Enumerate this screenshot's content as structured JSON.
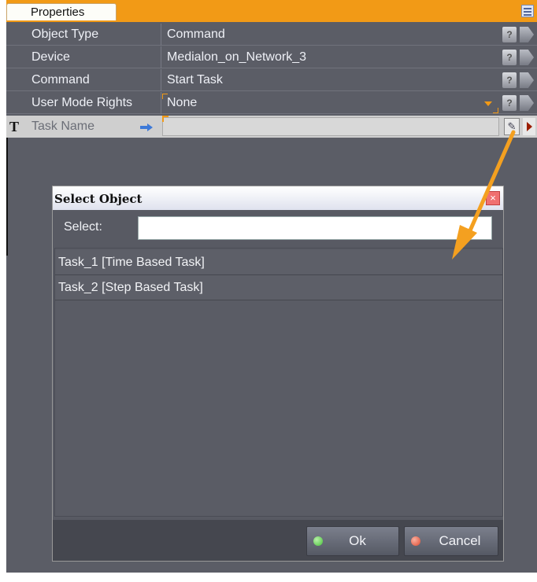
{
  "panel": {
    "tab_label": "Properties",
    "properties": [
      {
        "label": "Object Type",
        "value": "Command"
      },
      {
        "label": "Device",
        "value": "Medialon_on_Network_3"
      },
      {
        "label": "Command",
        "value": "Start Task"
      },
      {
        "label": "User Mode Rights",
        "value": "None"
      }
    ],
    "task_row": {
      "type_glyph": "T",
      "label": "Task Name",
      "value": ""
    },
    "help_glyph": "?",
    "icons": [
      "view-toggle-icon",
      "help-icon",
      "expand-arrow-icon",
      "dropdown-arrow-icon",
      "blue-right-arrow-icon",
      "object-picker-icon",
      "go-arrow-icon"
    ]
  },
  "dialog": {
    "title": "Select Object",
    "close_glyph": "×",
    "select_label": "Select:",
    "select_value": "",
    "items": [
      {
        "label": "Task_1 [Time Based Task]"
      },
      {
        "label": "Task_2 [Step Based Task]"
      }
    ],
    "ok_label": "Ok",
    "cancel_label": "Cancel"
  },
  "colors": {
    "accent": "#f29a16",
    "panel_bg": "#5b5d66",
    "ok_dot": "#47c13a",
    "cancel_dot": "#e04a30"
  }
}
